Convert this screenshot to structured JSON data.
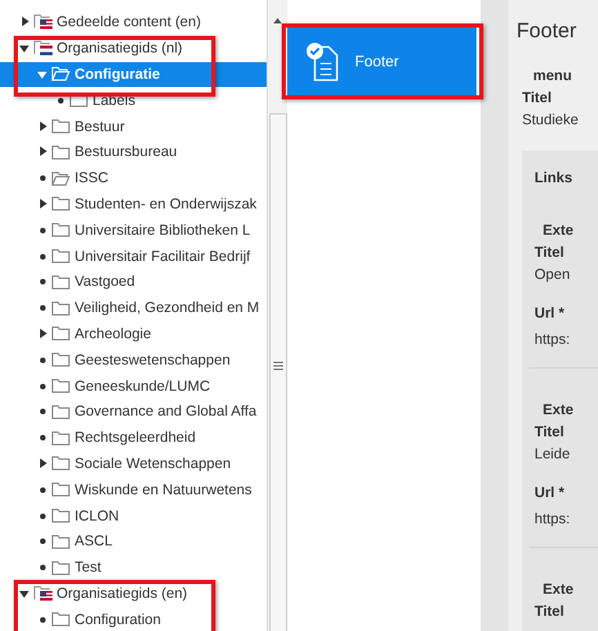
{
  "tree": [
    {
      "label": "Gedeelde content (en)",
      "kind": "flag_en",
      "expanded": false,
      "selected": false
    },
    {
      "label": "Organisatiegids (nl)",
      "kind": "flag_nl",
      "expanded": true,
      "selected": false,
      "children": [
        {
          "label": "Configuratie",
          "kind": "open_folder",
          "expanded": true,
          "selected": true,
          "children": [
            {
              "label": "Labels",
              "kind": "folder",
              "selected": false
            }
          ]
        },
        {
          "label": "Bestuur",
          "kind": "folder",
          "expanded": false,
          "selected": false
        },
        {
          "label": "Bestuursbureau",
          "kind": "folder",
          "expanded": false,
          "selected": false
        },
        {
          "label": "ISSC",
          "kind": "open_folder",
          "selected": false
        },
        {
          "label": "Studenten- en Onderwijszak",
          "kind": "folder",
          "expanded": false,
          "selected": false
        },
        {
          "label": "Universitaire Bibliotheken L",
          "kind": "folder",
          "selected": false
        },
        {
          "label": "Universitair Facilitair Bedrijf",
          "kind": "folder",
          "selected": false
        },
        {
          "label": "Vastgoed",
          "kind": "folder",
          "selected": false
        },
        {
          "label": "Veiligheid, Gezondheid en M",
          "kind": "folder",
          "selected": false
        },
        {
          "label": "Archeologie",
          "kind": "folder",
          "expanded": false,
          "selected": false
        },
        {
          "label": "Geesteswetenschappen",
          "kind": "folder",
          "selected": false
        },
        {
          "label": "Geneeskunde/LUMC",
          "kind": "folder",
          "selected": false
        },
        {
          "label": "Governance and Global Affa",
          "kind": "folder",
          "selected": false
        },
        {
          "label": "Rechtsgeleerdheid",
          "kind": "folder",
          "selected": false
        },
        {
          "label": "Sociale Wetenschappen",
          "kind": "folder",
          "expanded": false,
          "selected": false
        },
        {
          "label": "Wiskunde en Natuurwetens",
          "kind": "folder",
          "selected": false
        },
        {
          "label": "ICLON",
          "kind": "folder",
          "selected": false
        },
        {
          "label": "ASCL",
          "kind": "folder",
          "selected": false
        },
        {
          "label": "Test",
          "kind": "folder",
          "selected": false
        }
      ]
    },
    {
      "label": "Organisatiegids (en)",
      "kind": "flag_en",
      "expanded": true,
      "selected": false,
      "children": [
        {
          "label": "Configuration",
          "kind": "folder",
          "selected": false
        }
      ]
    }
  ],
  "items": [
    {
      "label": "Footer",
      "selected": true
    }
  ],
  "detail": {
    "title": "Footer",
    "section": "menu",
    "title_label": "Titel",
    "title_value": "Studieke",
    "group": "Links",
    "links": [
      {
        "heading": "Exte",
        "title_label": "Titel",
        "title_value": "Open",
        "url_label": "Url *",
        "url_value": "https:"
      },
      {
        "heading": "Exte",
        "title_label": "Titel",
        "title_value": "Leide",
        "url_label": "Url *",
        "url_value": "https:"
      },
      {
        "heading": "Exte",
        "title_label": "Titel"
      }
    ]
  }
}
